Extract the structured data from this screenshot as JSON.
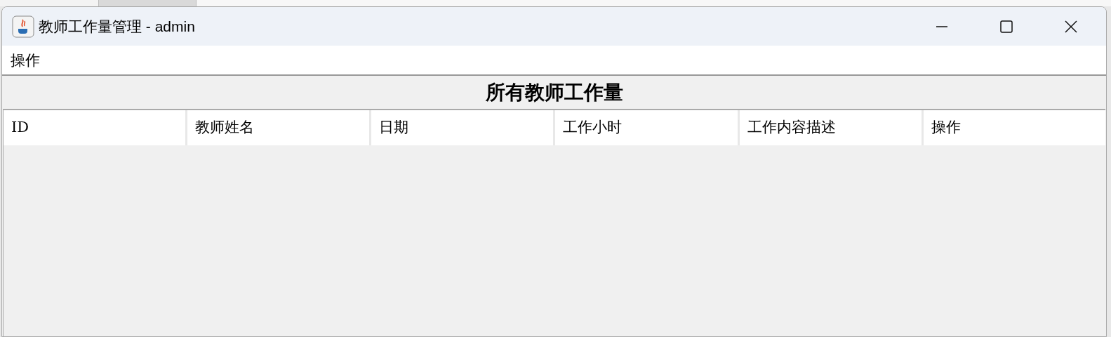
{
  "window": {
    "title": "教师工作量管理 - admin"
  },
  "menu_bar": {
    "items": [
      {
        "label": "操作"
      }
    ]
  },
  "heading": "所有教师工作量",
  "table": {
    "columns": [
      "ID",
      "教师姓名",
      "日期",
      "工作小时",
      "工作内容描述",
      "操作"
    ]
  }
}
